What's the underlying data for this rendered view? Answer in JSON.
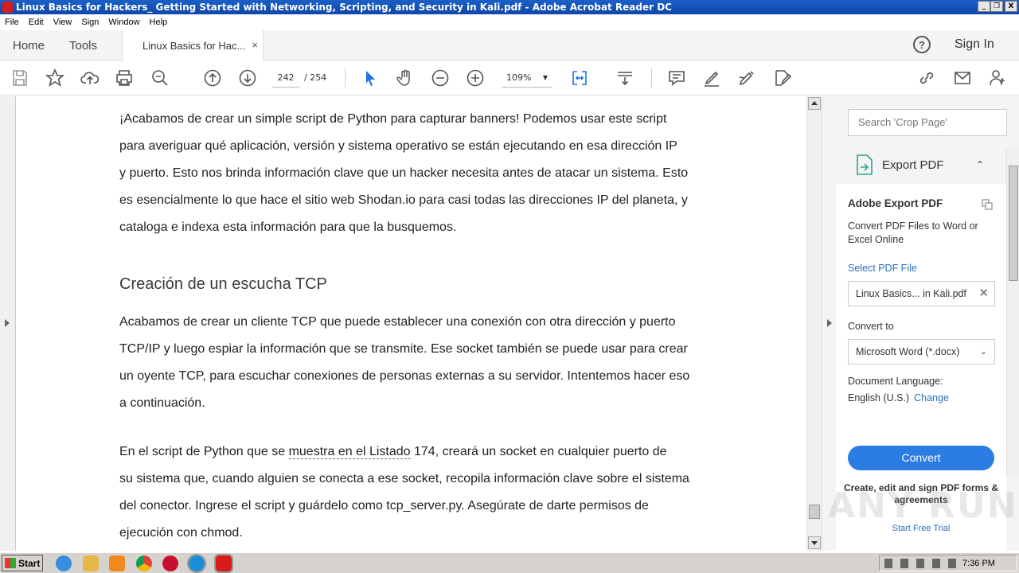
{
  "window": {
    "title": "Linux Basics for Hackers_ Getting Started with Networking, Scripting, and Security in Kali.pdf - Adobe Acrobat Reader DC",
    "minimize": "_",
    "restore": "❐",
    "close": "X"
  },
  "menu": [
    "File",
    "Edit",
    "View",
    "Sign",
    "Window",
    "Help"
  ],
  "tabs": {
    "home": "Home",
    "tools": "Tools",
    "document": "Linux Basics for Hac...",
    "close": "×",
    "help": "?",
    "sign_in": "Sign In"
  },
  "toolbar": {
    "page_current": "242",
    "page_total": "/ 254",
    "zoom": "109%",
    "zoom_arrow": "▼"
  },
  "document": {
    "para1": [
      "¡Acabamos de crear un simple script de Python para capturar banners! Podemos usar este script",
      "para averiguar qué aplicación, versión y sistema operativo se están ejecutando en esa dirección IP",
      "y puerto. Esto nos brinda información clave que un hacker necesita antes de atacar un sistema. Esto",
      "es esencialmente lo que hace el sitio web Shodan.io para casi todas las direcciones IP del planeta, y",
      "cataloga e indexa esta información para que la busquemos."
    ],
    "heading": "Creación de un escucha TCP",
    "para2": [
      "Acabamos de crear un cliente TCP que puede establecer una conexión con otra dirección y puerto",
      "TCP/IP y luego espiar la información que se transmite. Ese socket también se puede usar para crear",
      "un oyente TCP, para escuchar conexiones de personas externas a su servidor. Intentemos hacer eso",
      "a continuación."
    ],
    "para3": {
      "line1_pre": "En el script de Python que se ",
      "line1_link": "muestra en el Listado",
      "line1_post": " 174, creará un socket en cualquier puerto de",
      "lines": [
        "su sistema que, cuando alguien se conecta a ese socket, recopila información clave sobre el sistema",
        "del conector. Ingrese el script y guárdelo como tcp_server.py. Asegúrate de darte permisos de",
        "ejecución con chmod."
      ]
    }
  },
  "right_panel": {
    "search_placeholder": "Search 'Crop Page'",
    "export_title": "Export PDF",
    "export_chevron": "⌃",
    "card_title": "Adobe Export PDF",
    "card_desc": "Convert PDF Files to Word or Excel Online",
    "select_file": "Select PDF File",
    "file_name": "Linux Basics... in Kali.pdf",
    "file_remove": "✕",
    "convert_to": "Convert to",
    "format": "Microsoft Word (*.docx)",
    "format_chevron": "⌄",
    "doc_language_label": "Document Language:",
    "doc_language": "English (U.S.)",
    "change": "Change",
    "convert_button": "Convert",
    "promo": "Create, edit and sign PDF forms & agreements",
    "trial": "Start Free Trial"
  },
  "watermark": "ANY RUN",
  "taskbar": {
    "start": "Start",
    "clock": "7:36 PM"
  },
  "colors": {
    "accent": "#2b7de4",
    "title_bar": "#1b5fc7",
    "link": "#2a6fbd"
  }
}
